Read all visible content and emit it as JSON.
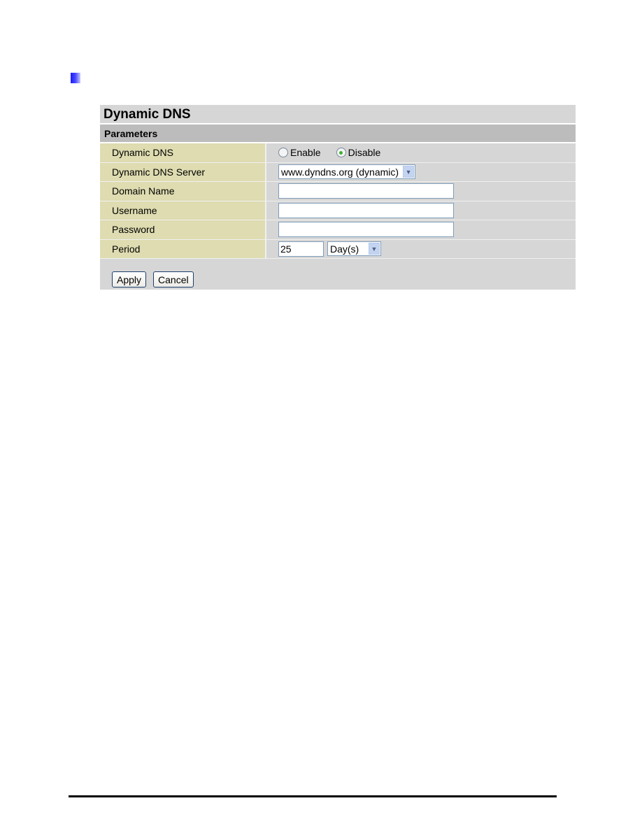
{
  "panel": {
    "title": "Dynamic DNS",
    "section": "Parameters",
    "rows": {
      "dynamic_dns": {
        "label": "Dynamic DNS",
        "options": [
          {
            "label": "Enable",
            "checked": false
          },
          {
            "label": "Disable",
            "checked": true
          }
        ]
      },
      "server": {
        "label": "Dynamic DNS Server",
        "selected": "www.dyndns.org (dynamic)"
      },
      "domain": {
        "label": "Domain Name",
        "value": ""
      },
      "username": {
        "label": "Username",
        "value": ""
      },
      "password": {
        "label": "Password",
        "value": ""
      },
      "period": {
        "label": "Period",
        "value": "25",
        "unit_selected": "Day(s)"
      }
    },
    "buttons": {
      "apply": "Apply",
      "cancel": "Cancel"
    }
  },
  "icons": {
    "bullet": "square-bullet-icon",
    "dropdown": "chevron-down-icon"
  }
}
